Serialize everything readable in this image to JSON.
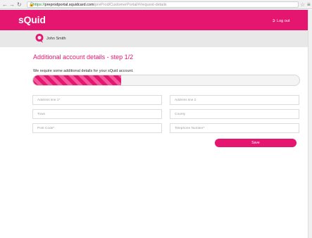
{
  "browser": {
    "back_icon": "arrow-left-icon",
    "forward_icon": "arrow-right-icon",
    "reload_icon": "reload-icon",
    "lock_icon": "lock-icon",
    "url_scheme": "https://",
    "url_host": "preprodportal.squidcard.com",
    "url_path": "/preProd/CustomerPortal/#/request-details"
  },
  "header": {
    "logo": "sQuid",
    "logout_label": "Log out",
    "brand_color": "#e5166f"
  },
  "user": {
    "name": "John Smith"
  },
  "main": {
    "title": "Additional account details - step 1/2",
    "subtitle": "We require some additional details for your sQuid account.",
    "progress_fraction": 0.33,
    "fields": {
      "address1_placeholder": "Address line 1*",
      "address2_placeholder": "Address line 2",
      "town_placeholder": "Town",
      "county_placeholder": "County",
      "postcode_placeholder": "Post Code*",
      "phone_placeholder": "Telephone Number*"
    },
    "save_label": "Save"
  }
}
